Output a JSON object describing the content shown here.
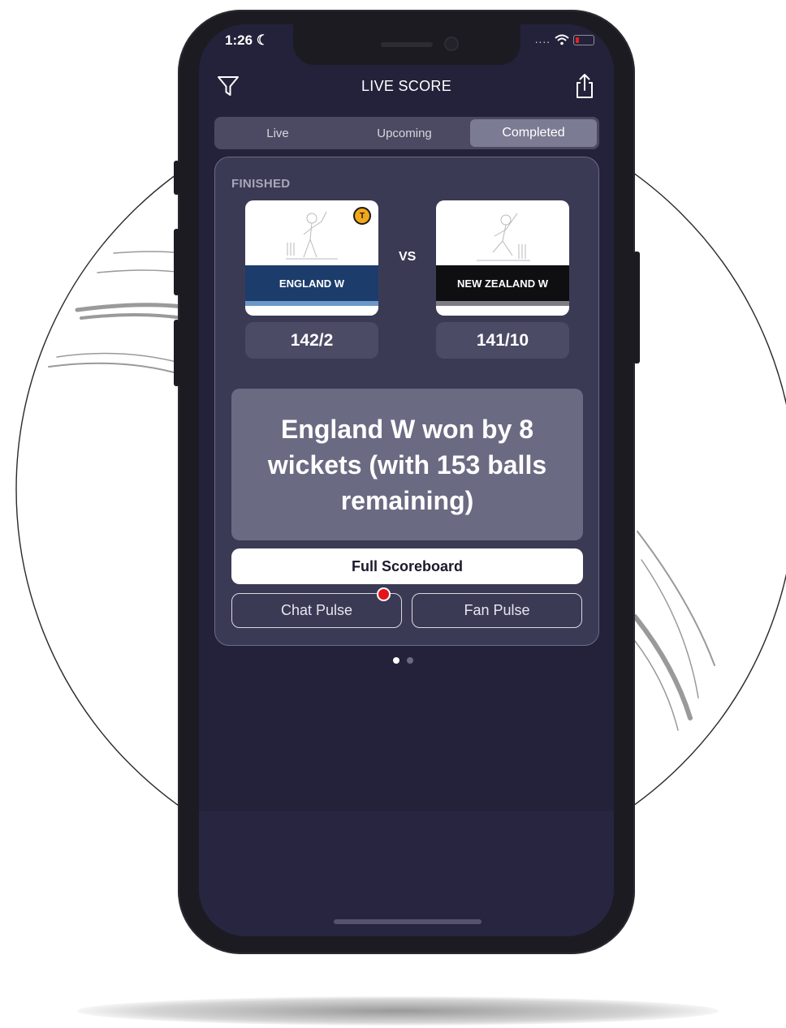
{
  "status_bar": {
    "time": "1:26 ☾"
  },
  "header": {
    "title": "LIVE SCORE"
  },
  "tabs": [
    {
      "label": "Live"
    },
    {
      "label": "Upcoming"
    },
    {
      "label": "Completed",
      "active": true
    }
  ],
  "match": {
    "status": "FINISHED",
    "vs_label": "VS",
    "team1": {
      "name": "ENGLAND W",
      "score": "142/2",
      "band_color": "#1c3c6b",
      "stripe_color": "#6c98c9",
      "badge": "T"
    },
    "team2": {
      "name": "NEW ZEALAND W",
      "score": "141/10",
      "band_color": "#0f0f12",
      "stripe_color": "#7d7d84"
    },
    "result": "England W won by 8 wickets (with 153 balls remaining)",
    "actions": {
      "full_scoreboard": "Full Scoreboard",
      "chat_pulse": "Chat Pulse",
      "fan_pulse": "Fan Pulse"
    }
  },
  "pager": {
    "pages": 2,
    "current": 1
  },
  "icons": [
    "filter-icon",
    "share-icon",
    "notification-dot"
  ]
}
